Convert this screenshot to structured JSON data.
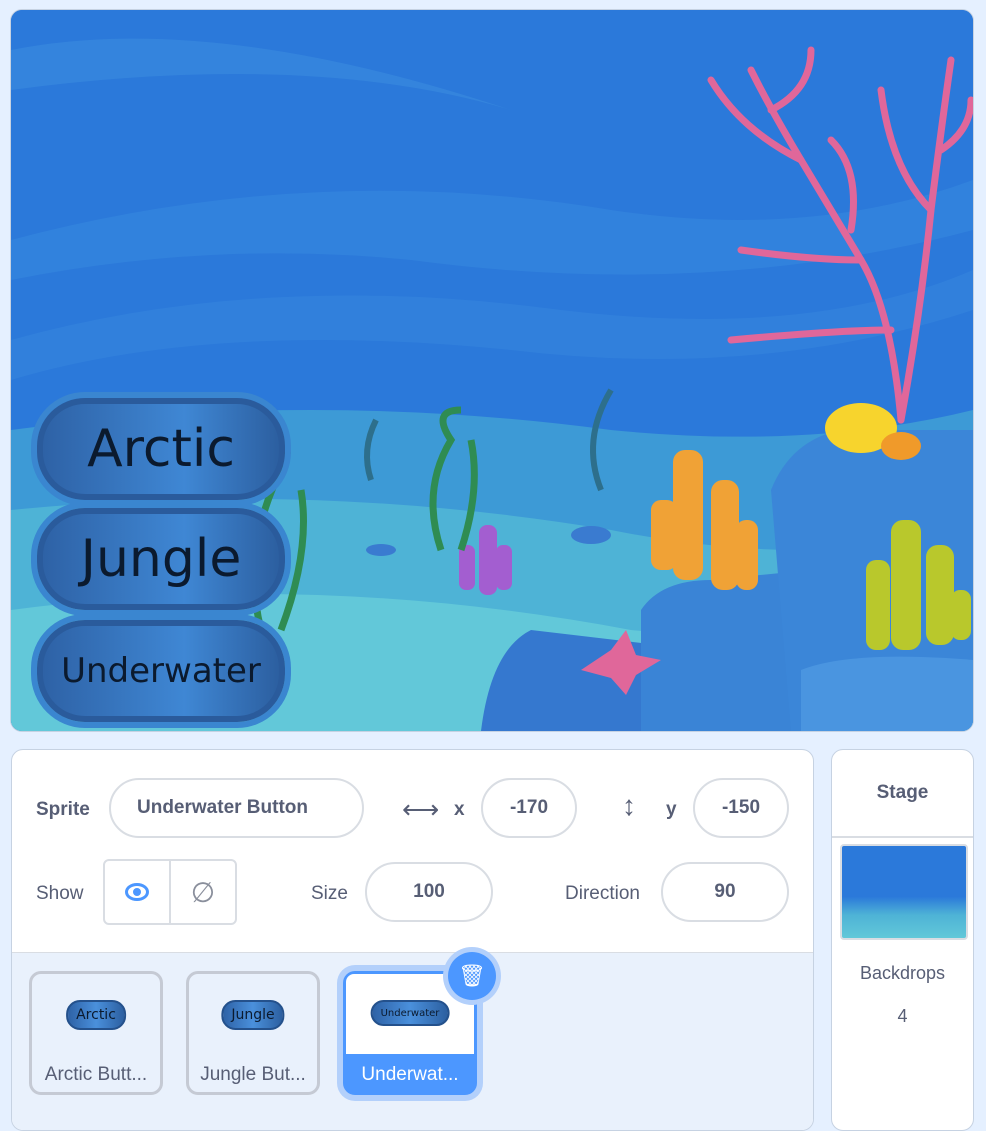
{
  "stage": {
    "sprite_buttons": [
      {
        "label": "Arctic"
      },
      {
        "label": "Jungle"
      },
      {
        "label": "Underwater"
      }
    ]
  },
  "sprite_info": {
    "sprite_label": "Sprite",
    "sprite_name": "Underwater Button",
    "x_label": "x",
    "x_value": "-170",
    "y_label": "y",
    "y_value": "-150",
    "show_label": "Show",
    "visible": true,
    "size_label": "Size",
    "size_value": "100",
    "direction_label": "Direction",
    "direction_value": "90"
  },
  "sprites": [
    {
      "thumb": "Arctic",
      "name": "Arctic Butt...",
      "selected": false
    },
    {
      "thumb": "Jungle",
      "name": "Jungle But...",
      "selected": false
    },
    {
      "thumb": "Underwater",
      "name": "Underwat...",
      "selected": true
    }
  ],
  "stage_panel": {
    "title": "Stage",
    "backdrops_label": "Backdrops",
    "backdrops_count": "4"
  },
  "colors": {
    "accent": "#4c97ff",
    "selected_tile": "#4c97ff"
  }
}
